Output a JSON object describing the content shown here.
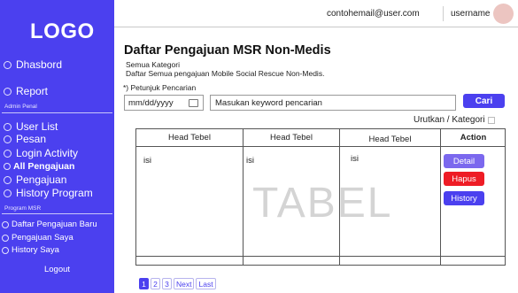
{
  "sidebar": {
    "logo": "LOGO",
    "main_items": [
      {
        "label": "Dhasbord"
      },
      {
        "label": "Report"
      }
    ],
    "admin_section_label": "Admin Penal",
    "admin_items": [
      {
        "label": "User List"
      },
      {
        "label": "Pesan"
      },
      {
        "label": "Login Activity"
      },
      {
        "label": "All Pengajuan"
      },
      {
        "label": "Pengajuan"
      },
      {
        "label": "History Program"
      }
    ],
    "program_section_label": "Program MSR",
    "program_items": [
      {
        "label": "Daftar Pengajuan Baru"
      },
      {
        "label": "Pengajuan Saya"
      },
      {
        "label": "History Saya"
      }
    ],
    "logout_label": "Logout"
  },
  "header": {
    "email": "contohemail@user.com",
    "username": "username"
  },
  "main": {
    "title": "Daftar Pengajuan MSR Non-Medis",
    "subtitle_1": "Semua Kategori",
    "subtitle_2": "Daftar Semua pengajuan Mobile Social Rescue Non-Medis.",
    "hint": "*) Petunjuk Pencarian",
    "date_placeholder": "mm/dd/yyyy",
    "search_placeholder": "Masukan keyword pencarian",
    "search_button": "Cari",
    "sort_label": "Urutkan / Kategori"
  },
  "table": {
    "headers": [
      "Head Tebel",
      "Head Tebel",
      "Head Tebel",
      "Action"
    ],
    "row": [
      "isi",
      "isi",
      "isi"
    ],
    "watermark": "TABEL",
    "actions": [
      {
        "label": "Detail",
        "color": "#7b68ee"
      },
      {
        "label": "Hapus",
        "color": "#ee1c25"
      },
      {
        "label": "History",
        "color": "#4b40ef"
      }
    ]
  },
  "pagination": {
    "pages": [
      "1",
      "2",
      "3"
    ],
    "next": "Next",
    "last": "Last",
    "current": "1"
  },
  "colors": {
    "brand": "#4b40ef",
    "danger": "#ee1c25",
    "detail": "#7b68ee"
  }
}
